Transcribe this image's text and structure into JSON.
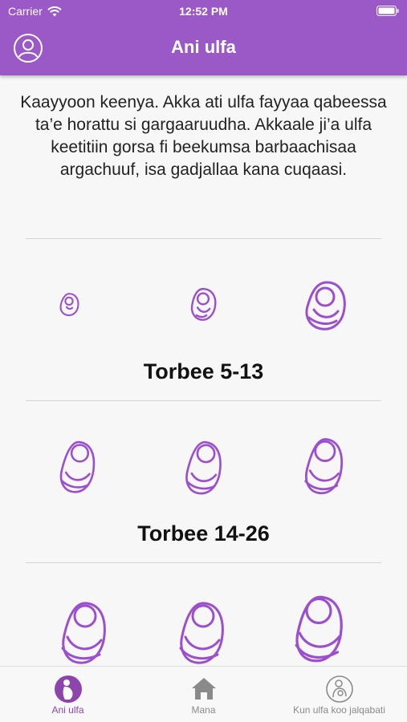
{
  "status_bar": {
    "carrier": "Carrier",
    "time": "12:52 PM"
  },
  "nav": {
    "title": "Ani ulfa"
  },
  "intro_text": "Kaayyoon keenya. Akka ati ulfa fayyaa qabeessa ta’e horattu si gargaaruudha. Akkaale ji’a ulfa keetitiin gorsa fi beekumsa barbaachisaa argachuuf, isa gadjallaa kana cuqaasi.",
  "trimesters": [
    {
      "label": "Torbee 5-13"
    },
    {
      "label": "Torbee 14-26"
    },
    {
      "label": ""
    }
  ],
  "tabs": [
    {
      "label": "Ani ulfa",
      "icon": "pregnant-woman-icon",
      "active": true
    },
    {
      "label": "Mana",
      "icon": "home-icon",
      "active": false
    },
    {
      "label": "Kun ulfa koo jalqabati",
      "icon": "mother-baby-icon",
      "active": false
    }
  ],
  "colors": {
    "accent": "#9b59c7",
    "fetus_stroke": "#9b4fcf",
    "active_tab": "#8e44ad"
  }
}
